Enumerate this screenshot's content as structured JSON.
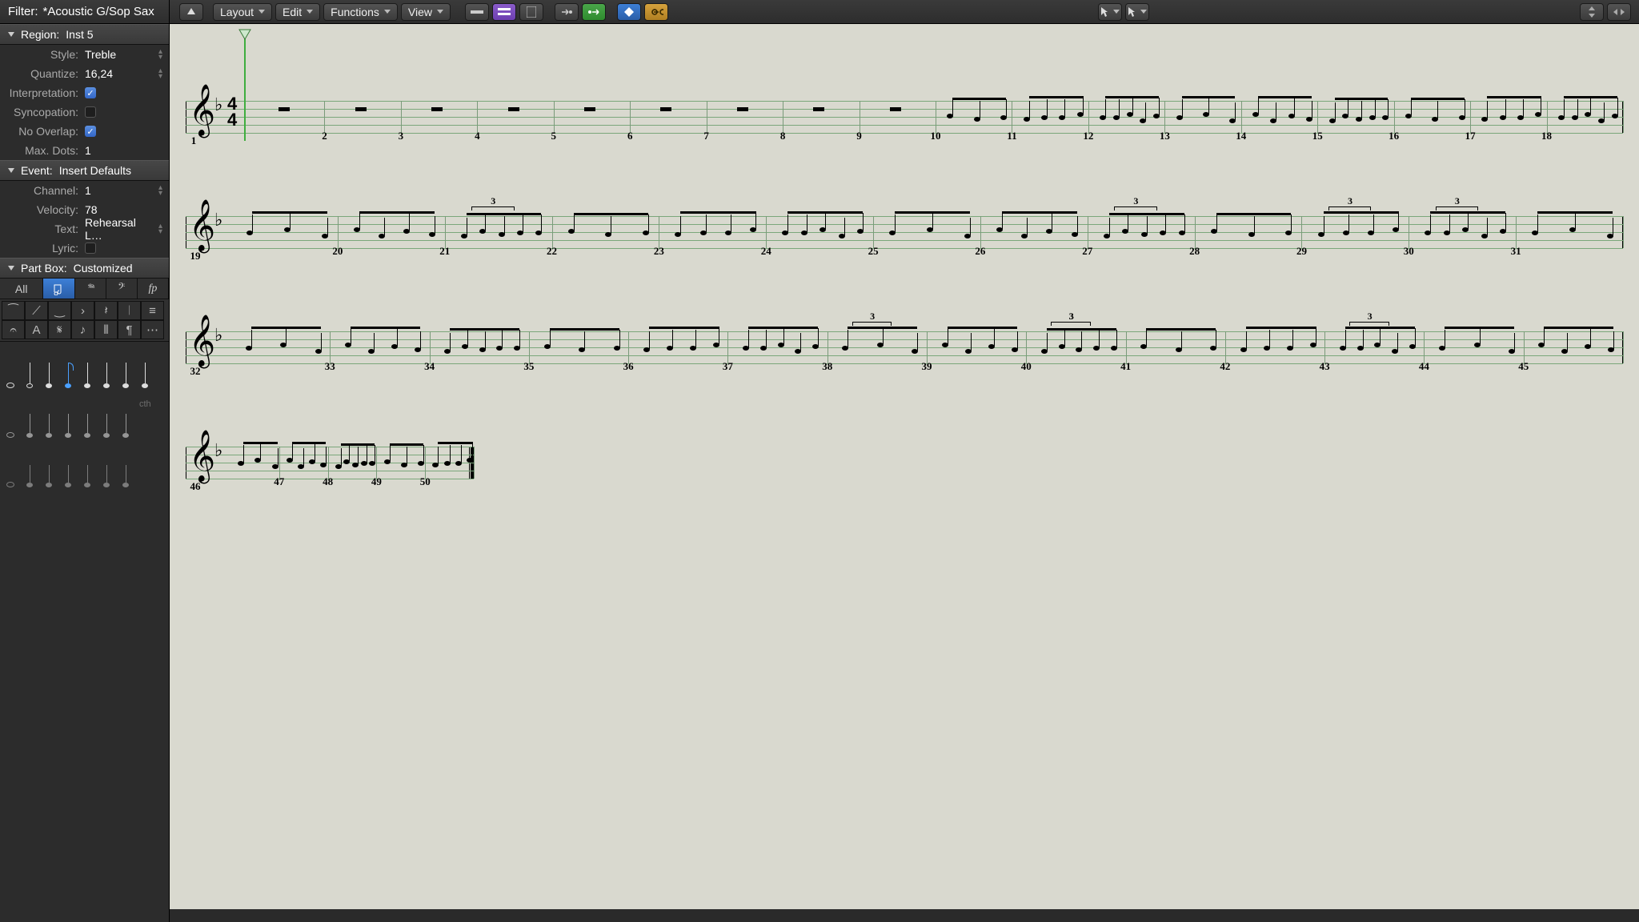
{
  "toolbar": {
    "filter_label": "Filter:",
    "filter_value": "*Acoustic G/Sop Sax",
    "menus": {
      "layout": "Layout",
      "edit": "Edit",
      "functions": "Functions",
      "view": "View"
    }
  },
  "region": {
    "header_label": "Region:",
    "header_value": "Inst 5",
    "style_label": "Style:",
    "style_value": "Treble",
    "quantize_label": "Quantize:",
    "quantize_value": "16,24",
    "interpretation_label": "Interpretation:",
    "interpretation_on": true,
    "syncopation_label": "Syncopation:",
    "syncopation_on": false,
    "nooverlap_label": "No Overlap:",
    "nooverlap_on": true,
    "maxdots_label": "Max. Dots:",
    "maxdots_value": "1"
  },
  "event": {
    "header_label": "Event:",
    "header_value": "Insert Defaults",
    "channel_label": "Channel:",
    "channel_value": "1",
    "velocity_label": "Velocity:",
    "velocity_value": "78",
    "text_label": "Text:",
    "text_value": "Rehearsal L…",
    "lyric_label": "Lyric:",
    "lyric_on": false
  },
  "partbox": {
    "header_label": "Part Box:",
    "header_value": "Customized",
    "tabs": [
      "All"
    ],
    "symbol_categories": [
      "note-beamed",
      "ped",
      "bass-clef",
      "fp"
    ],
    "grid_icons": [
      "tie",
      "gliss",
      "slur",
      "accent",
      "rest",
      "barline",
      "tremolo",
      "fermata",
      "text",
      "segno",
      "grace",
      "repeat",
      "measure",
      "custom"
    ]
  },
  "score": {
    "clef": "𝄞",
    "flat": "♭",
    "timesig_top": "4",
    "timesig_bot": "4",
    "systems": [
      {
        "first": 1,
        "bars": [
          1,
          2,
          3,
          4,
          5,
          6,
          7,
          8,
          9,
          10,
          11,
          12,
          13,
          14,
          15,
          16,
          17,
          18
        ]
      },
      {
        "first": 19,
        "bars": [
          19,
          20,
          21,
          22,
          23,
          24,
          25,
          26,
          27,
          28,
          29,
          30,
          31
        ]
      },
      {
        "first": 32,
        "bars": [
          32,
          33,
          34,
          35,
          36,
          37,
          38,
          39,
          40,
          41,
          42,
          43,
          44,
          45
        ]
      },
      {
        "first": 46,
        "bars": [
          46,
          47,
          48,
          49,
          50
        ]
      }
    ],
    "tuplet_label": "3"
  }
}
